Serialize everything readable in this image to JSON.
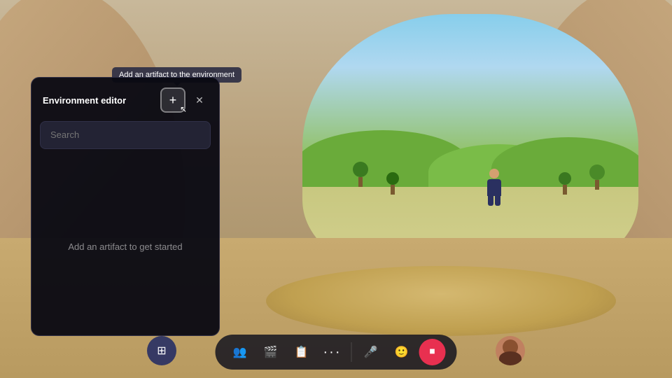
{
  "scene": {
    "bg_color": "#b8a070"
  },
  "tooltip": {
    "text": "Add an artifact to the environment"
  },
  "env_panel": {
    "title": "Environment editor",
    "add_button_label": "+",
    "close_button_label": "✕",
    "search_placeholder": "Search",
    "empty_state_text": "Add an artifact to get started"
  },
  "toolbar": {
    "buttons": [
      {
        "id": "people",
        "icon": "👥",
        "label": "people"
      },
      {
        "id": "video",
        "icon": "🎬",
        "label": "video"
      },
      {
        "id": "share",
        "icon": "📋",
        "label": "share"
      },
      {
        "id": "more",
        "icon": "···",
        "label": "more"
      },
      {
        "id": "mic",
        "icon": "🎤",
        "label": "mic"
      },
      {
        "id": "emoji",
        "icon": "🙂",
        "label": "emoji"
      },
      {
        "id": "stop",
        "icon": "⏹",
        "label": "stop-sharing",
        "active": true
      }
    ],
    "left_apps_icon": "⊞",
    "right_avatar_label": "avatar"
  }
}
